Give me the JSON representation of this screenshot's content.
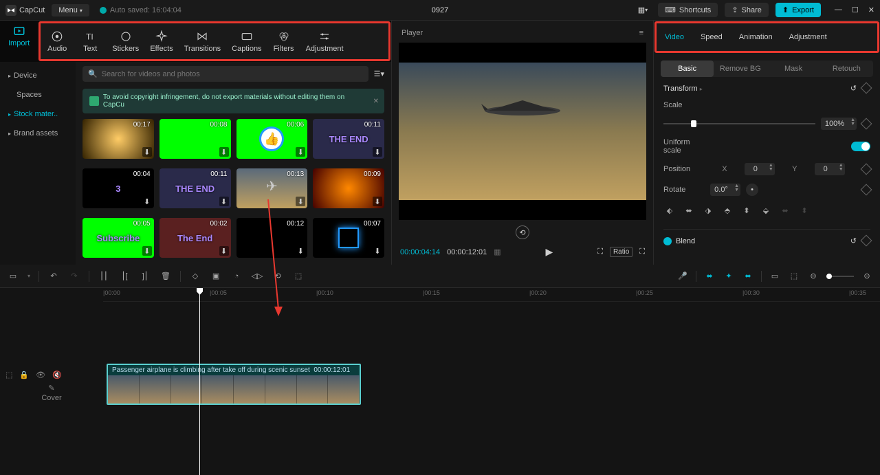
{
  "titlebar": {
    "app_name": "CapCut",
    "menu_label": "Menu",
    "autosave_text": "Auto saved: 16:04:04",
    "project_name": "0927",
    "shortcuts_label": "Shortcuts",
    "share_label": "Share",
    "export_label": "Export"
  },
  "top_tabs": {
    "import": "Import",
    "audio": "Audio",
    "text": "Text",
    "stickers": "Stickers",
    "effects": "Effects",
    "transitions": "Transitions",
    "captions": "Captions",
    "filters": "Filters",
    "adjustment": "Adjustment"
  },
  "left_sidebar": {
    "device": "Device",
    "spaces": "Spaces",
    "stock": "Stock mater..",
    "brand": "Brand assets"
  },
  "search": {
    "placeholder": "Search for videos and photos"
  },
  "copyright_notice": "To avoid copyright infringement, do not export materials without editing them on CapCu",
  "thumbs": [
    {
      "dur": "00:17",
      "bg": "radial-gradient(circle,#fc6,#320)"
    },
    {
      "dur": "00:08",
      "bg": "#0f0"
    },
    {
      "dur": "00:06",
      "bg": "#0f0",
      "overlay": "thumbs-up"
    },
    {
      "dur": "00:11",
      "bg": "#2a2a4a",
      "text": "THE END"
    },
    {
      "dur": "00:04",
      "bg": "#000",
      "text": "3"
    },
    {
      "dur": "00:11",
      "bg": "#2a2a4a",
      "text": "THE END"
    },
    {
      "dur": "00:13",
      "bg": "linear-gradient(180deg,#5a6a7a,#c0a060)",
      "plane": true
    },
    {
      "dur": "00:09",
      "bg": "radial-gradient(circle,#f80,#400)"
    },
    {
      "dur": "00:05",
      "bg": "#0f0",
      "text": "Subscribe"
    },
    {
      "dur": "00:02",
      "bg": "#5a2020",
      "text": "The End"
    },
    {
      "dur": "00:12",
      "bg": "#000"
    },
    {
      "dur": "00:07",
      "bg": "#000",
      "square": true
    }
  ],
  "player": {
    "header": "Player",
    "current_time": "00:00:04:14",
    "total_time": "00:00:12:01",
    "ratio_label": "Ratio"
  },
  "right_tabs": {
    "video": "Video",
    "speed": "Speed",
    "animation": "Animation",
    "adjustment": "Adjustment"
  },
  "sub_tabs": {
    "basic": "Basic",
    "removebg": "Remove BG",
    "mask": "Mask",
    "retouch": "Retouch"
  },
  "inspector": {
    "transform_title": "Transform",
    "scale_label": "Scale",
    "scale_value": "100%",
    "uniform_label": "Uniform scale",
    "position_label": "Position",
    "position_x_label": "X",
    "position_x_value": "0",
    "position_y_label": "Y",
    "position_y_value": "0",
    "rotate_label": "Rotate",
    "rotate_value": "0.0°",
    "blend_label": "Blend"
  },
  "timeline": {
    "cover_label": "Cover",
    "ticks": [
      "00:00",
      "00:05",
      "00:10",
      "00:15",
      "00:20",
      "00:25",
      "00:30",
      "00:35"
    ],
    "clip_label": "Passenger airplane is climbing after take off during scenic sunset",
    "clip_duration": "00:00:12:01"
  }
}
